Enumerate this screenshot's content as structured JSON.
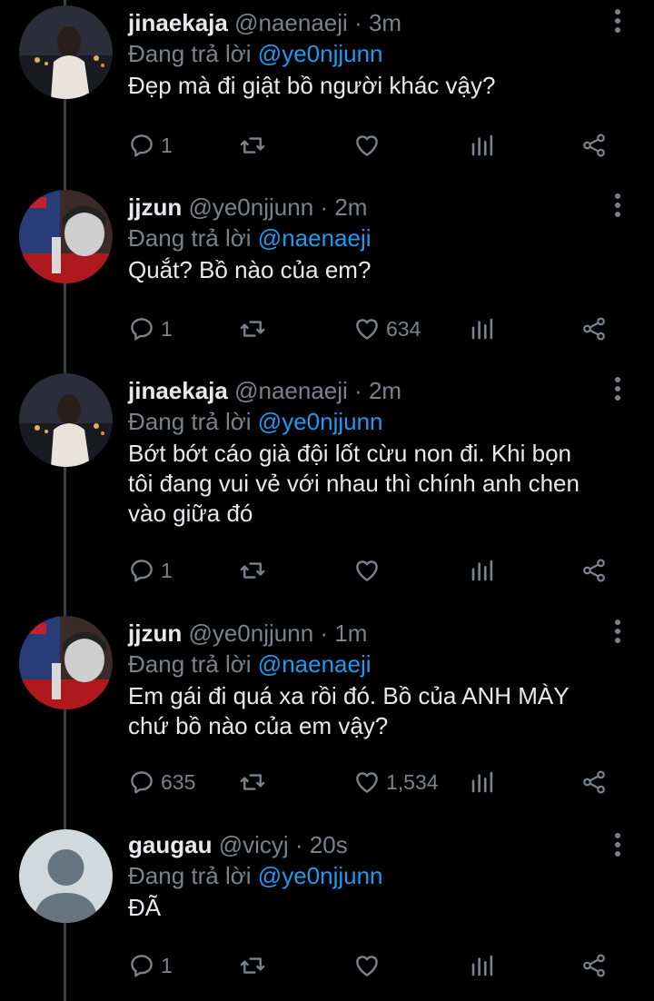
{
  "colors": {
    "background": "#000000",
    "text": "#e7e9ea",
    "muted": "#7a838b",
    "accent": "#1d9bf0"
  },
  "replying_prefix": "Đang trả lời",
  "tweets": [
    {
      "name": "jinaekaja",
      "handle": "@naenaeji",
      "time": "3m",
      "replying_to": "@ye0njjunn",
      "avatar": "avatar-jinaekaja",
      "lines": [
        "Đẹp mà đi giật bồ người khác vậy?"
      ],
      "replies": "1",
      "retweets": "",
      "likes": ""
    },
    {
      "name": "jjzun",
      "handle": "@ye0njjunn",
      "time": "2m",
      "replying_to": "@naenaeji",
      "avatar": "avatar-jjzun",
      "lines": [
        "Quắt? Bồ nào của em?"
      ],
      "replies": "1",
      "retweets": "",
      "likes": "634"
    },
    {
      "name": "jinaekaja",
      "handle": "@naenaeji",
      "time": "2m",
      "replying_to": "@ye0njjunn",
      "avatar": "avatar-jinaekaja",
      "lines": [
        "Bớt bớt cáo già đội lốt cừu non đi. Khi bọn",
        "tôi đang vui vẻ với nhau thì chính anh chen",
        "vào giữa đó"
      ],
      "replies": "1",
      "retweets": "",
      "likes": ""
    },
    {
      "name": "jjzun",
      "handle": "@ye0njjunn",
      "time": "1m",
      "replying_to": "@naenaeji",
      "avatar": "avatar-jjzun",
      "lines": [
        "Em gái đi quá xa rồi đó. Bồ của ANH MÀY",
        "chứ bồ nào của em vậy?"
      ],
      "replies": "635",
      "retweets": "",
      "likes": "1,534"
    },
    {
      "name": "gaugau",
      "handle": "@vicyj",
      "time": "20s",
      "replying_to": "@ye0njjunn",
      "avatar": "avatar-default",
      "lines": [
        "ĐÃ"
      ],
      "replies": "1",
      "retweets": "",
      "likes": ""
    }
  ]
}
